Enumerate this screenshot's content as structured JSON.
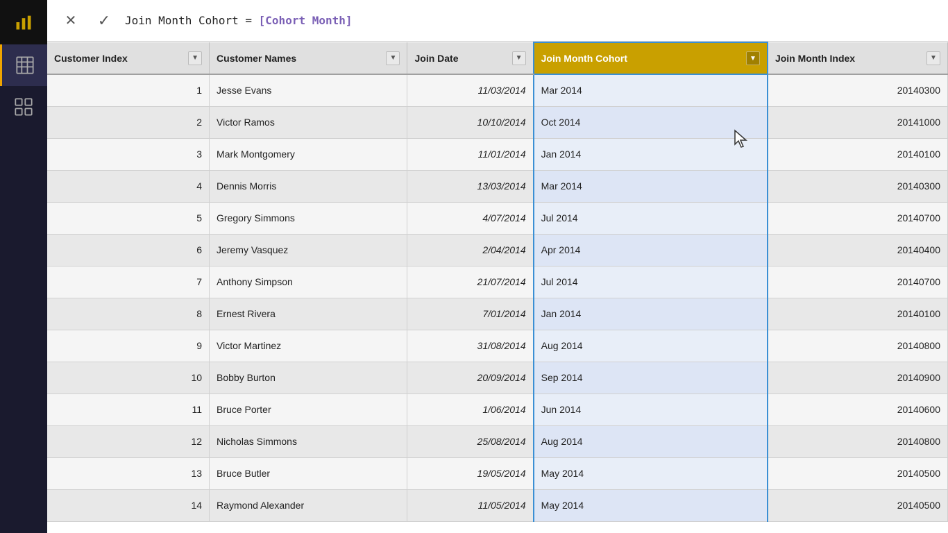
{
  "formula": {
    "text": "Join Month Cohort = [Cohort Month]",
    "plain": "Join Month Cohort = ",
    "highlight": "[Cohort Month]",
    "cancel_label": "✕",
    "confirm_label": "✓"
  },
  "columns": [
    {
      "id": "customer-index",
      "label": "Customer Index",
      "class": "col-customer-index"
    },
    {
      "id": "customer-names",
      "label": "Customer Names",
      "class": "col-customer-names"
    },
    {
      "id": "join-date",
      "label": "Join Date",
      "class": "col-join-date"
    },
    {
      "id": "join-month-cohort",
      "label": "Join Month Cohort",
      "class": "col-join-month-cohort"
    },
    {
      "id": "join-month-index",
      "label": "Join Month Index",
      "class": "col-join-month-index"
    }
  ],
  "rows": [
    {
      "index": 1,
      "name": "Jesse Evans",
      "date": "11/03/2014",
      "cohort": "Mar 2014",
      "monthIndex": "20140300"
    },
    {
      "index": 2,
      "name": "Victor Ramos",
      "date": "10/10/2014",
      "cohort": "Oct 2014",
      "monthIndex": "20141000"
    },
    {
      "index": 3,
      "name": "Mark Montgomery",
      "date": "11/01/2014",
      "cohort": "Jan 2014",
      "monthIndex": "20140100"
    },
    {
      "index": 4,
      "name": "Dennis Morris",
      "date": "13/03/2014",
      "cohort": "Mar 2014",
      "monthIndex": "20140300"
    },
    {
      "index": 5,
      "name": "Gregory Simmons",
      "date": "4/07/2014",
      "cohort": "Jul 2014",
      "monthIndex": "20140700"
    },
    {
      "index": 6,
      "name": "Jeremy Vasquez",
      "date": "2/04/2014",
      "cohort": "Apr 2014",
      "monthIndex": "20140400"
    },
    {
      "index": 7,
      "name": "Anthony Simpson",
      "date": "21/07/2014",
      "cohort": "Jul 2014",
      "monthIndex": "20140700"
    },
    {
      "index": 8,
      "name": "Ernest Rivera",
      "date": "7/01/2014",
      "cohort": "Jan 2014",
      "monthIndex": "20140100"
    },
    {
      "index": 9,
      "name": "Victor Martinez",
      "date": "31/08/2014",
      "cohort": "Aug 2014",
      "monthIndex": "20140800"
    },
    {
      "index": 10,
      "name": "Bobby Burton",
      "date": "20/09/2014",
      "cohort": "Sep 2014",
      "monthIndex": "20140900"
    },
    {
      "index": 11,
      "name": "Bruce Porter",
      "date": "1/06/2014",
      "cohort": "Jun 2014",
      "monthIndex": "20140600"
    },
    {
      "index": 12,
      "name": "Nicholas Simmons",
      "date": "25/08/2014",
      "cohort": "Aug 2014",
      "monthIndex": "20140800"
    },
    {
      "index": 13,
      "name": "Bruce Butler",
      "date": "19/05/2014",
      "cohort": "May 2014",
      "monthIndex": "20140500"
    },
    {
      "index": 14,
      "name": "Raymond Alexander",
      "date": "11/05/2014",
      "cohort": "May 2014",
      "monthIndex": "20140500"
    }
  ],
  "sidebar": {
    "icons": [
      {
        "id": "bar-chart",
        "symbol": "📊"
      },
      {
        "id": "table",
        "symbol": "⊞"
      },
      {
        "id": "model",
        "symbol": "⊟"
      }
    ]
  }
}
